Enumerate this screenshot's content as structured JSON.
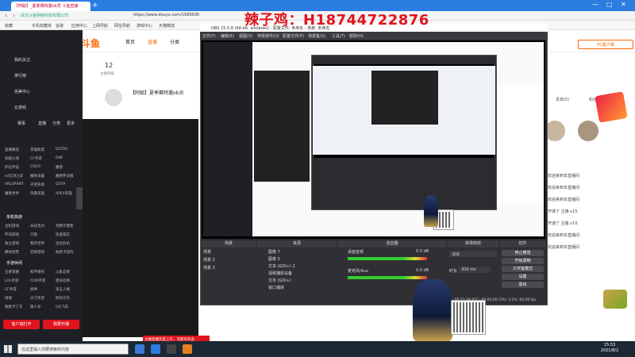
{
  "browser": {
    "tab_title": "【阿聪】_夏季赛特邀ob员 斗鱼直播",
    "tab_new": "+",
    "url": "https://www.douyu.com/1589936",
    "site_name": "武汉斗鱼网络科技有限公司",
    "bookmarks": [
      "收藏",
      "手机收藏夹",
      "谷歌",
      "应用中心",
      "上网导航",
      "网址导航",
      "游戏中心",
      "天猫精选"
    ],
    "window_controls": [
      "—",
      "□",
      "✕"
    ]
  },
  "overlay": {
    "watermark": "辣子鸡：H18744722876",
    "accent": "#e0141e"
  },
  "douyu": {
    "logo": "斗鱼",
    "header_nav": [
      "首页",
      "直播",
      "分类"
    ],
    "pc_client": "PC客户端",
    "streamer_title": "【阿聪】夏季赛特邀ob员",
    "level_count": "12",
    "level_label": "主播等级",
    "left_nav": [
      "我的关注",
      "排行榜",
      "完美中心",
      "云游戏"
    ],
    "left_nav_extra": [
      "赛事",
      "直播",
      "分类",
      "更多"
    ],
    "left_grid": [
      [
        "直播精选",
        "英雄联盟",
        "DOTA2"
      ],
      [
        "穿越火线",
        "CF手游",
        "DNF"
      ],
      [
        "炉石传说",
        "CSGO",
        "魔兽"
      ],
      [
        "lol云顶之弈",
        "魔兽争霸",
        "魔兽怀旧服"
      ],
      [
        "VALORANT",
        "守望先锋",
        "DOTA"
      ],
      [
        "魔兽世界",
        "风暴英雄",
        "APEX英雄"
      ]
    ],
    "mobile_section": "单机热游",
    "mobile_grid": [
      [
        "主机游戏",
        "永劫无间",
        "荒野大镖客"
      ],
      [
        "怀旧游戏",
        "只狼",
        "侠盗猎车"
      ],
      [
        "独立游戏",
        "我的世界",
        "生化危机"
      ],
      [
        "模拟经营",
        "恐怖游戏",
        "帕斯卡契约"
      ]
    ],
    "phone_section": "手游休闲",
    "phone_grid": [
      [
        "王者荣耀",
        "和平精英",
        "火影忍者"
      ],
      [
        "LOL手游",
        "COD手游",
        "使命召唤"
      ],
      [
        "CF手游",
        "原神",
        "第五人格"
      ],
      [
        "球球",
        "天刀手游",
        "明日方舟"
      ],
      [
        "跑跑卡丁车",
        "狼人杀",
        "QQ飞车"
      ]
    ],
    "bottom_buttons": [
      "客户端打开",
      "我要开播"
    ],
    "rank_tabs": [
      "贵宾(0)",
      "粉丝团"
    ],
    "chat_messages": [
      "欢迎来到本直播间",
      "欢迎来到本直播间",
      "欢迎来到本直播间",
      "开通了 主播 x15",
      "开通了 主播 x10",
      "欢迎来到本直播间",
      "欢迎来到本直播间"
    ],
    "toast": "主播直播热度上升，可能有机会"
  },
  "obs": {
    "title": "OBS 25.0.8 (64-bit, windows) - 配置文件: 未命名 - 场景: 未命名",
    "menu": [
      "文件(F)",
      "编辑(E)",
      "视图(V)",
      "停靠部件(D)",
      "配置文件(P)",
      "场景集(S)",
      "工具(T)",
      "帮助(H)"
    ],
    "dock_headers": [
      "场景",
      "来源",
      "混音器",
      "转场特效",
      "控件"
    ],
    "scenes": [
      "场景",
      "场景 2",
      "场景 3"
    ],
    "sources": [
      "图像 7",
      "图像 5",
      "文本 (GDI+) 2",
      "视频捕获设备",
      "文本 (GDI+)",
      "窗口捕获"
    ],
    "mixer_channels": [
      {
        "name": "桌面音频",
        "db": "0.0 dB"
      },
      {
        "name": "麦克风/Aux",
        "db": "0.0 dB"
      }
    ],
    "transition": "淡出",
    "duration_label": "时长",
    "duration": "300 ms",
    "controls": [
      "停止推流",
      "开始录制",
      "工作室模式",
      "设置",
      "退出"
    ],
    "status": "LIVE: 00:21:39  REC: 00:00:00  CPU: 3.1%, 60.00 fps"
  },
  "taskbar": {
    "search_placeholder": "在这里输入你要搜索的内容",
    "time": "15:53",
    "date": "2021/8/2"
  }
}
